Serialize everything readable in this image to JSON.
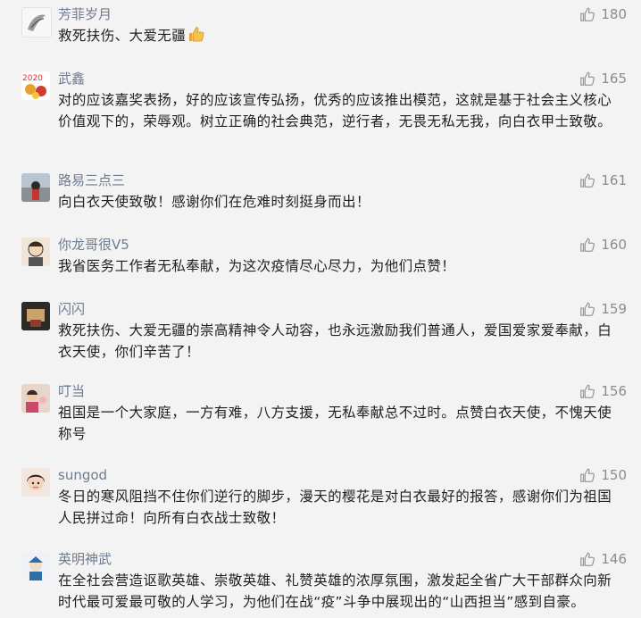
{
  "comments": [
    {
      "name": "芳菲岁月",
      "text": "救死扶伤、大爱无疆",
      "likes": "180",
      "emoji": "thumbs-up-emoji"
    },
    {
      "name": "武鑫",
      "text": "对的应该嘉奖表扬，好的应该宣传弘扬，优秀的应该推出模范，这就是基于社会主义核心价值观下的，荣辱观。树立正确的社会典范，逆行者，无畏无私无我，向白衣甲士致敬。",
      "likes": "165"
    },
    {
      "name": "路易三点三",
      "text": "向白衣天使致敬！感谢你们在危难时刻挺身而出！",
      "likes": "161"
    },
    {
      "name": "你龙哥很V5",
      "text": "我省医务工作者无私奉献，为这次疫情尽心尽力，为他们点赞！",
      "likes": "160"
    },
    {
      "name": "闪闪",
      "text": "救死扶伤、大爱无疆的崇高精神令人动容，也永远激励我们普通人，爱国爱家爱奉献，白衣天使，你们辛苦了！",
      "likes": "159"
    },
    {
      "name": "叮当",
      "text": "祖国是一个大家庭，一方有难，八方支援，无私奉献总不过时。点赞白衣天使，不愧天使称号",
      "likes": "156"
    },
    {
      "name": "sungod",
      "text": "冬日的寒风阻挡不住你们逆行的脚步，漫天的樱花是对白衣最好的报答，感谢你们为祖国人民拼过命！向所有白衣战士致敬！",
      "likes": "150"
    },
    {
      "name": "英明神武",
      "text": "在全社会营造讴歌英雄、崇敬英雄、礼赞英雄的浓厚氛围，激发起全省广大干部群众向新时代最可爱最可敬的人学习，为他们在战“疫”斗争中展现出的“山西担当”感到自豪。",
      "likes": "146"
    }
  ]
}
